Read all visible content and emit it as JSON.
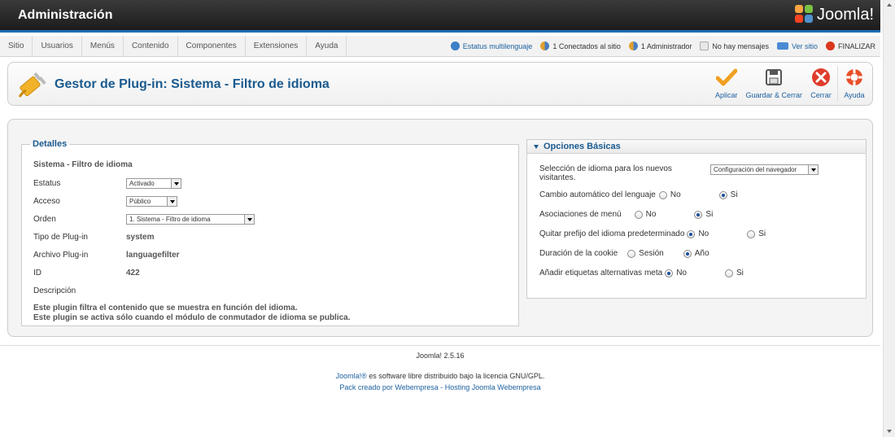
{
  "header": {
    "title": "Administración",
    "logo_text": "Joomla!"
  },
  "menu": [
    "Sitio",
    "Usuarios",
    "Menús",
    "Contenido",
    "Componentes",
    "Extensiones",
    "Ayuda"
  ],
  "status": {
    "multilang": "Estatus multilenguaje",
    "online": "1 Conectados al sitio",
    "admins": "1 Administrador",
    "messages": "No hay mensajes",
    "view_site": "Ver sitio",
    "logout": "FINALIZAR"
  },
  "toolbar": {
    "title": "Gestor de Plug-in: Sistema - Filtro de idioma",
    "apply": "Aplicar",
    "save_close": "Guardar & Cerrar",
    "close": "Cerrar",
    "help": "Ayuda"
  },
  "details": {
    "legend": "Detalles",
    "plugin_name": "Sistema - Filtro de idioma",
    "status_label": "Estatus",
    "status_value": "Activado",
    "access_label": "Acceso",
    "access_value": "Público",
    "order_label": "Orden",
    "order_value": "1. Sistema - Filtro de idioma",
    "type_label": "Tipo de Plug-in",
    "type_value": "system",
    "file_label": "Archivo Plug-in",
    "file_value": "languagefilter",
    "id_label": "ID",
    "id_value": "422",
    "desc_label": "Descripción",
    "desc_line1": "Este plugin filtra el contenido que se muestra en función del idioma.",
    "desc_line2": "Este plugin se activa sólo cuando el módulo de conmutador de idioma se publica."
  },
  "options": {
    "title": "Opciones Básicas",
    "lang_select_label": "Selección de idioma para los nuevos visitantes.",
    "lang_select_value": "Configuración del navegador",
    "auto_change_label": "Cambio automático del lenguaje",
    "menu_assoc_label": "Asociaciones de menú",
    "remove_prefix_label": "Quitar prefijo del idioma predeterminado",
    "cookie_label": "Duración de la cookie",
    "meta_label": "Añadir etiquetas alternativas meta",
    "no": "No",
    "yes": "Si",
    "session": "Sesión",
    "year": "Año"
  },
  "footer": {
    "version": "Joomla! 2.5.16",
    "license_link": "Joomla!®",
    "license_text": " es software libre distribuido bajo la licencia GNU/GPL.",
    "pack": "Pack creado por Webempresa - Hosting Joomla Webempresa"
  },
  "colors": {
    "accent_blue": "#1b6fb5",
    "title_blue": "#1a5a8e",
    "apply_orange": "#f0a020",
    "close_red": "#e03c2c"
  }
}
